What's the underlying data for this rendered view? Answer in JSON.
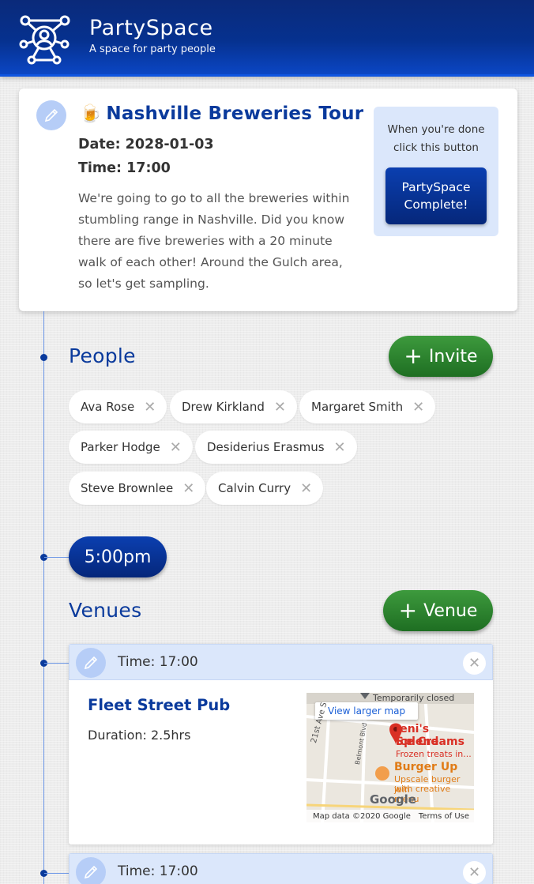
{
  "app": {
    "name": "PartySpace",
    "tagline": "A space for party people"
  },
  "event": {
    "emoji": "🍺",
    "title": "Nashville Breweries Tour",
    "date": "Date: 2028-01-03",
    "time": "Time: 17:00",
    "description": "We're going to go to all the breweries within stumbling range in Nashville. Did you know there are five breweries with a 20 minute walk of each other! Around the Gulch area, so let's get sampling.",
    "done_prompt": "When you're done click this button",
    "complete_label": "PartySpace Complete!"
  },
  "people": {
    "title": "People",
    "invite_label": "Invite",
    "remove_symbol": "✕",
    "list": [
      "Ava Rose",
      "Drew Kirkland",
      "Margaret Smith",
      "Parker Hodge",
      "Desiderius Erasmus",
      "Steve Brownlee",
      "Calvin Curry"
    ]
  },
  "schedule": {
    "time_pill": "5:00pm"
  },
  "venues": {
    "title": "Venues",
    "add_label": "Venue",
    "items": [
      {
        "time": "Time: 17:00",
        "name": "Fleet Street Pub",
        "duration": "Duration: 2.5hrs",
        "map": {
          "view_larger": "View larger map",
          "temporarily_closed": "Temporarily closed",
          "place1_name_a": "Jeni's Splend",
          "place1_name_b": "Ice Creams",
          "place1_desc": "Frozen treats in...",
          "place2_name": "Burger Up",
          "place2_desc_a": "Upscale burger join",
          "place2_desc_b": "with creative menu",
          "street1": "21st Ave S",
          "street2": "Belmont Blvd",
          "google": "Google",
          "attribution": "Map data ©2020 Google",
          "terms": "Terms of Use"
        }
      },
      {
        "time": "Time: 17:00"
      }
    ]
  },
  "colors": {
    "brand_blue": "#0a3a9c",
    "accent_green": "#2e7d32",
    "light_blue_panel": "#dbe7fb"
  }
}
